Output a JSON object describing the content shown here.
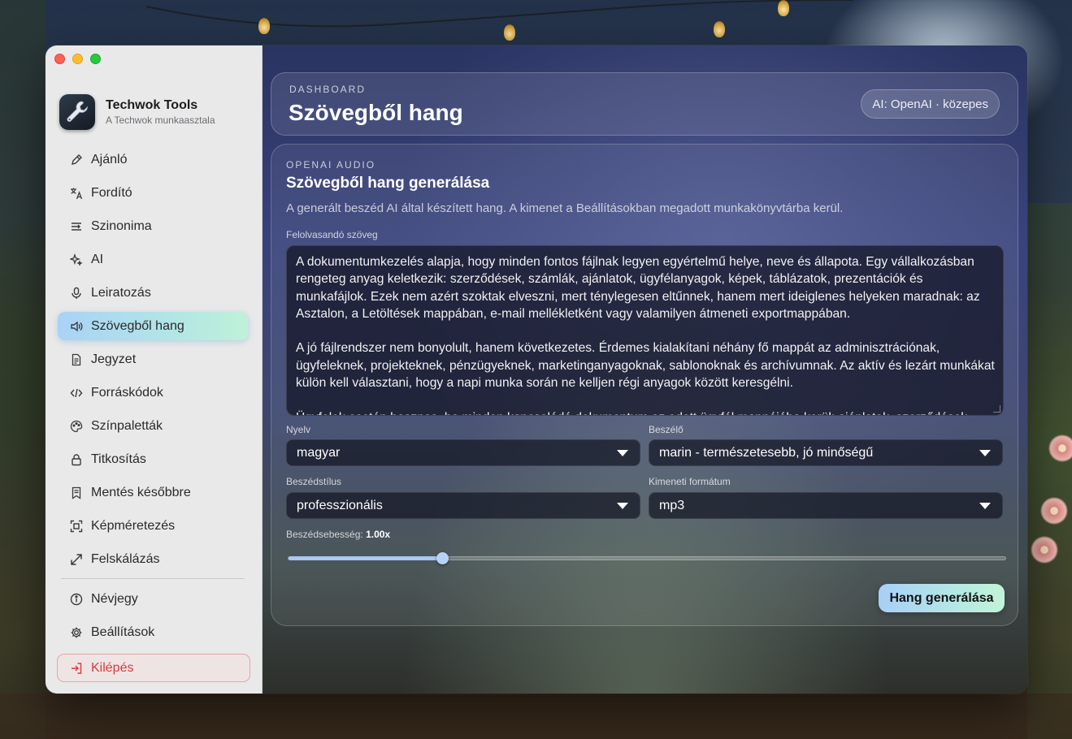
{
  "window": {
    "traffic_lights": {
      "close": "#fe5f57",
      "minimize": "#febc2e",
      "zoom": "#28c840"
    }
  },
  "sidebar": {
    "app_name": "Techwok Tools",
    "app_subtitle": "A Techwok munkaasztala",
    "items": [
      {
        "label": "Ajánló",
        "icon": "pen-sparkle-icon",
        "active": false
      },
      {
        "label": "Fordító",
        "icon": "translate-icon",
        "active": false
      },
      {
        "label": "Szinonima",
        "icon": "list-arrow-icon",
        "active": false
      },
      {
        "label": "AI",
        "icon": "sparkles-icon",
        "active": false
      },
      {
        "label": "Leiratozás",
        "icon": "microphone-icon",
        "active": false
      },
      {
        "label": "Szövegből hang",
        "icon": "speaker-icon",
        "active": true
      },
      {
        "label": "Jegyzet",
        "icon": "document-icon",
        "active": false
      },
      {
        "label": "Forráskódok",
        "icon": "code-icon",
        "active": false
      },
      {
        "label": "Színpaletták",
        "icon": "palette-icon",
        "active": false
      },
      {
        "label": "Titkosítás",
        "icon": "lock-icon",
        "active": false
      },
      {
        "label": "Mentés későbbre",
        "icon": "bookmark-list-icon",
        "active": false
      },
      {
        "label": "Képméretezés",
        "icon": "crop-frame-icon",
        "active": false
      },
      {
        "label": "Felskálázás",
        "icon": "expand-arrows-icon",
        "active": false
      }
    ],
    "bottom_items": [
      {
        "label": "Névjegy",
        "icon": "info-icon"
      },
      {
        "label": "Beállítások",
        "icon": "gear-icon"
      }
    ],
    "logout_label": "Kilépés",
    "active_gradient": [
      "#a9d2f6",
      "#bff1d9"
    ],
    "logout_color": "#d83a3a"
  },
  "header": {
    "eyebrow": "DASHBOARD",
    "title": "Szövegből hang",
    "ai_badge": "AI: OpenAI · közepes"
  },
  "content": {
    "eyebrow": "OPENAI AUDIO",
    "title": "Szövegből hang generálása",
    "description": "A generált beszéd AI által készített hang. A kimenet a Beállításokban megadott munkakönyvtárba kerül.",
    "text_label": "Felolvasandó szöveg",
    "text_paragraphs": [
      "A dokumentumkezelés alapja, hogy minden fontos fájlnak legyen egyértelmű helye, neve és állapota. Egy vállalkozásban rengeteg anyag keletkezik: szerződések, számlák, ajánlatok, ügyfélanyagok, képek, táblázatok, prezentációk és munkafájlok. Ezek nem azért szoktak elveszni, mert ténylegesen eltűnnek, hanem mert ideiglenes helyeken maradnak: az Asztalon, a Letöltések mappában, e-mail mellékletként vagy valamilyen átmeneti exportmappában.",
      "A jó fájlrendszer nem bonyolult, hanem következetes. Érdemes kialakítani néhány fő mappát az adminisztrációnak, ügyfeleknek, projekteknek, pénzügyeknek, marketinganyagoknak, sablonoknak és archívumnak. Az aktív és lezárt munkákat külön kell választani, hogy a napi munka során ne kelljen régi anyagok között keresgélni.",
      "Ügyfelek esetén hasznos, ha minden kapcsolódó dokumentum az adott ügyfél mappájába kerül: ajánlatok, szerződések"
    ],
    "language_label": "Nyelv",
    "language_value": "magyar",
    "speaker_label": "Beszélő",
    "speaker_value": "marin - természetesebb, jó minőségű",
    "style_label": "Beszédstílus",
    "style_value": "professzionális",
    "format_label": "Kimeneti formátum",
    "format_value": "mp3",
    "speed_label": "Beszédsebesség:",
    "speed_value": "1.00x",
    "speed_fraction": 0.214,
    "generate_label": "Hang generálása",
    "accent_color": "#a9c8f2"
  }
}
